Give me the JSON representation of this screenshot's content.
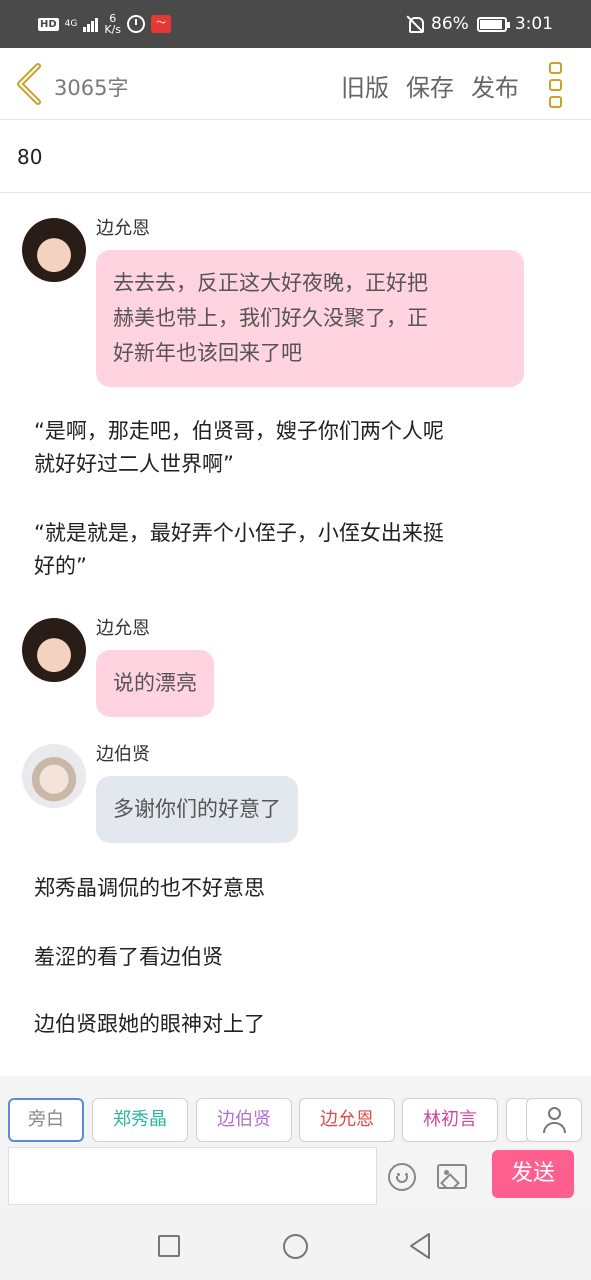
{
  "status_bar": {
    "hd": "HD",
    "network": "4G",
    "speed_value": "6",
    "speed_unit": "K/s",
    "battery": "86%",
    "time": "3:01",
    "battery_level": 0.86
  },
  "top_bar": {
    "word_count": "3065字",
    "old_version": "旧版",
    "save": "保存",
    "publish": "发布"
  },
  "chapter": {
    "number": "80"
  },
  "messages": [
    {
      "type": "dialog",
      "sender": "边允恩",
      "avatar": "female-avatar",
      "bubble_color": "#ffd3df",
      "lines": [
        "去去去，反正这大好夜晚，正好把",
        "赫美也带上，我们好久没聚了，正",
        "好新年也该回来了吧"
      ]
    },
    {
      "type": "narration",
      "lines": [
        "“是啊，那走吧，伯贤哥，嫂子你们两个人呢",
        "就好好过二人世界啊”"
      ]
    },
    {
      "type": "narration",
      "lines": [
        "“就是就是，最好弄个小侄子，小侄女出来挺",
        "好的”"
      ]
    },
    {
      "type": "dialog",
      "sender": "边允恩",
      "avatar": "female-avatar",
      "bubble_color": "#ffd3df",
      "lines": [
        "说的漂亮"
      ]
    },
    {
      "type": "dialog",
      "sender": "边伯贤",
      "avatar": "male-avatar",
      "bubble_color": "#e3e7ee",
      "lines": [
        "多谢你们的好意了"
      ]
    },
    {
      "type": "narration",
      "lines": [
        "郑秀晶调侃的也不好意思"
      ]
    },
    {
      "type": "narration",
      "lines": [
        "羞涩的看了看边伯贤"
      ]
    },
    {
      "type": "narration",
      "lines": [
        "边伯贤跟她的眼神对上了"
      ]
    }
  ],
  "roles": [
    {
      "label": "旁白",
      "color": "#888888"
    },
    {
      "label": "郑秀晶",
      "color": "#2bb5a0"
    },
    {
      "label": "边伯贤",
      "color": "#b56fd0"
    },
    {
      "label": "边允恩",
      "color": "#e04a4a"
    },
    {
      "label": "林初言",
      "color": "#d0479a"
    }
  ],
  "composer": {
    "input_value": "",
    "send": "发送"
  },
  "colors": {
    "accent_gold": "#c9a227",
    "send_pink": "#ff5f8e",
    "narrator_border": "#5b8bd6"
  }
}
